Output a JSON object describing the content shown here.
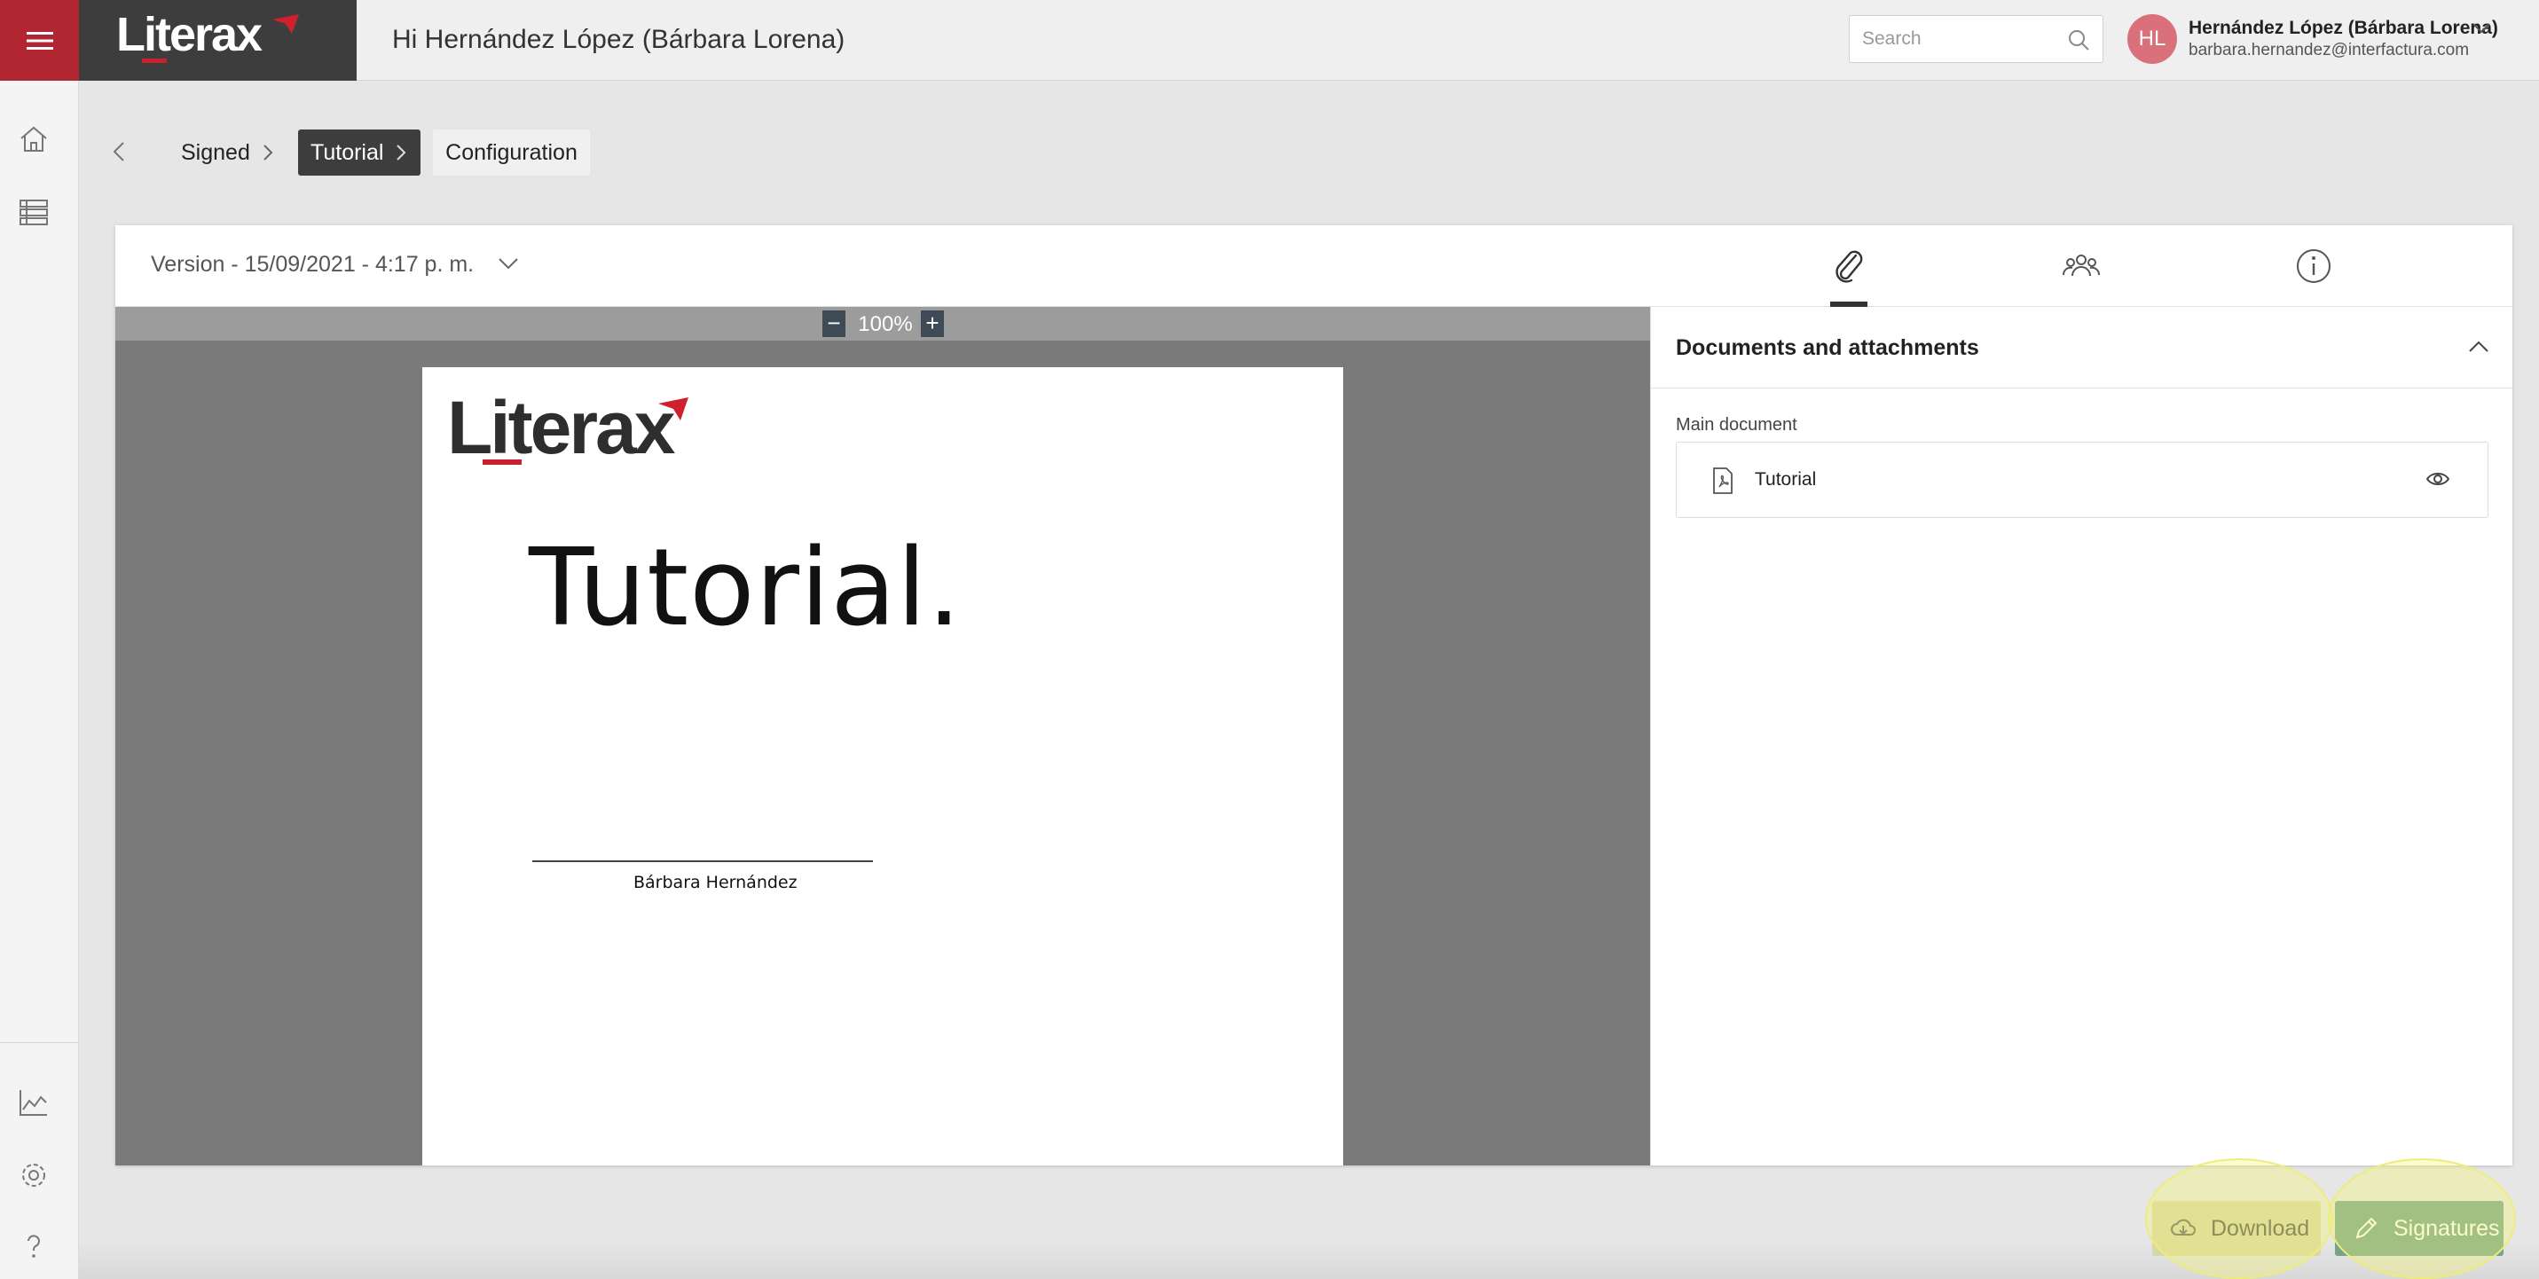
{
  "header": {
    "brand": "Literax",
    "greeting": "Hi Hernández López (Bárbara Lorena)",
    "search_placeholder": "Search",
    "avatar_initials": "HL",
    "user_name": "Hernández López (Bárbara Lorena)",
    "user_email": "barbara.hernandez@interfactura.com"
  },
  "sidebar": {
    "items": [
      "home-icon",
      "list-icon",
      "chart-icon",
      "gear-icon",
      "help-icon"
    ]
  },
  "breadcrumb": {
    "items": [
      {
        "label": "Signed"
      },
      {
        "label": "Tutorial"
      },
      {
        "label": "Configuration"
      }
    ]
  },
  "card": {
    "version_label": "Version - 15/09/2021 - 4:17 p. m.",
    "tabs": [
      "paperclip-icon",
      "people-icon",
      "info-icon"
    ]
  },
  "viewer": {
    "zoom": "100%",
    "page": {
      "logo_text": "Literax",
      "title": "Tutorial.",
      "signer_name": "Bárbara Hernández"
    }
  },
  "panel": {
    "title": "Documents and attachments",
    "main_document_label": "Main document",
    "documents": [
      {
        "name": "Tutorial"
      }
    ]
  },
  "actions": {
    "download_label": "Download",
    "signatures_label": "Signatures"
  },
  "colors": {
    "brand_red": "#b22632",
    "brand_dark": "#3d3d3d",
    "signatures_green": "#74a58c",
    "download_bg": "#d8d7a8",
    "avatar_pink": "#d9707a"
  }
}
